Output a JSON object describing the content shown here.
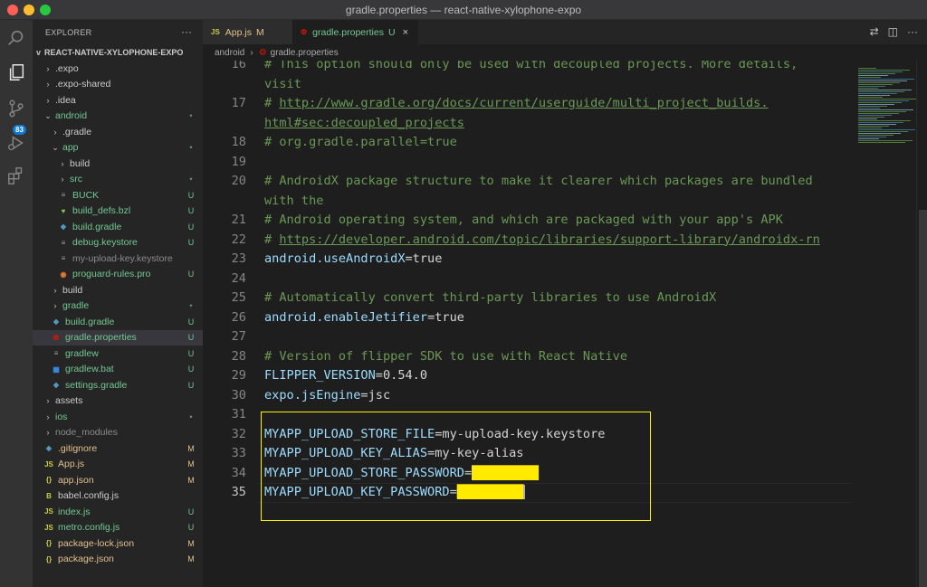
{
  "window": {
    "title": "gradle.properties — react-native-xylophone-expo"
  },
  "activity": {
    "source_control_badge": "83"
  },
  "explorer": {
    "header": "EXPLORER",
    "more": "···",
    "root": "REACT-NATIVE-XYLOPHONE-EXPO",
    "items": [
      {
        "label": ".expo",
        "chev": ">",
        "icon": "",
        "status": ""
      },
      {
        "label": ".expo-shared",
        "chev": ">",
        "icon": "",
        "status": ""
      },
      {
        "label": ".idea",
        "chev": ">",
        "icon": "",
        "status": ""
      },
      {
        "label": "android",
        "chev": "v",
        "icon": "",
        "status": "•"
      },
      {
        "label": ".gradle",
        "chev": ">",
        "icon": "",
        "status": ""
      },
      {
        "label": "app",
        "chev": "v",
        "icon": "",
        "status": "•"
      },
      {
        "label": "build",
        "chev": ">",
        "icon": "",
        "status": ""
      },
      {
        "label": "src",
        "chev": ">",
        "icon": "",
        "status": "•"
      },
      {
        "label": "BUCK",
        "chev": "",
        "icon": "≡",
        "status": "U"
      },
      {
        "label": "build_defs.bzl",
        "chev": "",
        "icon": "♥",
        "status": "U"
      },
      {
        "label": "build.gradle",
        "chev": "",
        "icon": "◆",
        "status": "U"
      },
      {
        "label": "debug.keystore",
        "chev": "",
        "icon": "≡",
        "status": "U"
      },
      {
        "label": "my-upload-key.keystore",
        "chev": "",
        "icon": "≡",
        "status": ""
      },
      {
        "label": "proguard-rules.pro",
        "chev": "",
        "icon": "◉",
        "status": "U"
      },
      {
        "label": "build",
        "chev": ">",
        "icon": "",
        "status": ""
      },
      {
        "label": "gradle",
        "chev": ">",
        "icon": "",
        "status": "•"
      },
      {
        "label": "build.gradle",
        "chev": "",
        "icon": "◆",
        "status": "U"
      },
      {
        "label": "gradle.properties",
        "chev": "",
        "icon": "⚙",
        "status": "U"
      },
      {
        "label": "gradlew",
        "chev": "",
        "icon": "≡",
        "status": "U"
      },
      {
        "label": "gradlew.bat",
        "chev": "",
        "icon": "▦",
        "status": "U"
      },
      {
        "label": "settings.gradle",
        "chev": "",
        "icon": "◆",
        "status": "U"
      },
      {
        "label": "assets",
        "chev": ">",
        "icon": "",
        "status": ""
      },
      {
        "label": "ios",
        "chev": ">",
        "icon": "",
        "status": "•"
      },
      {
        "label": "node_modules",
        "chev": ">",
        "icon": "",
        "status": ""
      },
      {
        "label": ".gitignore",
        "chev": "",
        "icon": "◆",
        "status": "M"
      },
      {
        "label": "App.js",
        "chev": "",
        "icon": "JS",
        "status": "M"
      },
      {
        "label": "app.json",
        "chev": "",
        "icon": "{}",
        "status": "M"
      },
      {
        "label": "babel.config.js",
        "chev": "",
        "icon": "B",
        "status": ""
      },
      {
        "label": "index.js",
        "chev": "",
        "icon": "JS",
        "status": "U"
      },
      {
        "label": "metro.config.js",
        "chev": "",
        "icon": "JS",
        "status": "U"
      },
      {
        "label": "package-lock.json",
        "chev": "",
        "icon": "{}",
        "status": "M"
      },
      {
        "label": "package.json",
        "chev": "",
        "icon": "{}",
        "status": "M"
      }
    ]
  },
  "tabs": [
    {
      "icon": "JS",
      "label": "App.js",
      "mark": "M"
    },
    {
      "icon": "⚙",
      "label": "gradle.properties",
      "mark": "U",
      "close": "×"
    }
  ],
  "breadcrumb": {
    "folder": "android",
    "sep": "›",
    "file": "gradle.properties"
  },
  "editor": {
    "lines": [
      {
        "num": "16",
        "parts": [
          {
            "t": "# This option should only be used with decoupled projects. More details,",
            "c": "cm"
          }
        ]
      },
      {
        "num": "",
        "parts": [
          {
            "t": "visit",
            "c": "cm"
          }
        ]
      },
      {
        "num": "17",
        "parts": [
          {
            "t": "# ",
            "c": "cm"
          },
          {
            "t": "http://www.gradle.org/docs/current/userguide/multi_project_builds.",
            "c": "url"
          }
        ]
      },
      {
        "num": "",
        "parts": [
          {
            "t": "html#sec:decoupled_projects",
            "c": "url"
          }
        ]
      },
      {
        "num": "18",
        "parts": [
          {
            "t": "# org.gradle.parallel=true",
            "c": "cm"
          }
        ]
      },
      {
        "num": "19",
        "parts": []
      },
      {
        "num": "20",
        "parts": [
          {
            "t": "# AndroidX package structure to make it clearer which packages are bundled",
            "c": "cm"
          }
        ]
      },
      {
        "num": "",
        "parts": [
          {
            "t": "with the",
            "c": "cm"
          }
        ]
      },
      {
        "num": "21",
        "parts": [
          {
            "t": "# Android operating system, and which are packaged with your app's APK",
            "c": "cm"
          }
        ]
      },
      {
        "num": "22",
        "parts": [
          {
            "t": "# ",
            "c": "cm"
          },
          {
            "t": "https://developer.android.com/topic/libraries/support-library/androidx-rn",
            "c": "url"
          }
        ]
      },
      {
        "num": "23",
        "parts": [
          {
            "t": "android.useAndroidX",
            "c": "key"
          },
          {
            "t": "=true",
            "c": "val"
          }
        ]
      },
      {
        "num": "24",
        "parts": []
      },
      {
        "num": "25",
        "parts": [
          {
            "t": "# Automatically convert third-party libraries to use AndroidX",
            "c": "cm"
          }
        ]
      },
      {
        "num": "26",
        "parts": [
          {
            "t": "android.enableJetifier",
            "c": "key"
          },
          {
            "t": "=true",
            "c": "val"
          }
        ]
      },
      {
        "num": "27",
        "parts": []
      },
      {
        "num": "28",
        "parts": [
          {
            "t": "# Version of flipper SDK to use with React Native",
            "c": "cm"
          }
        ]
      },
      {
        "num": "29",
        "parts": [
          {
            "t": "FLIPPER_VERSION",
            "c": "key"
          },
          {
            "t": "=0.54.0",
            "c": "val"
          }
        ]
      },
      {
        "num": "30",
        "parts": [
          {
            "t": "expo.jsEngine",
            "c": "key"
          },
          {
            "t": "=jsc",
            "c": "val"
          }
        ]
      },
      {
        "num": "31",
        "parts": []
      },
      {
        "num": "32",
        "parts": [
          {
            "t": "MYAPP_UPLOAD_STORE_FILE",
            "c": "key"
          },
          {
            "t": "=my-upload-key.keystore",
            "c": "val"
          }
        ]
      },
      {
        "num": "33",
        "parts": [
          {
            "t": "MYAPP_UPLOAD_KEY_ALIAS",
            "c": "key"
          },
          {
            "t": "=my-key-alias",
            "c": "val"
          }
        ]
      },
      {
        "num": "34",
        "parts": [
          {
            "t": "MYAPP_UPLOAD_STORE_PASSWORD",
            "c": "key"
          },
          {
            "t": "=",
            "c": "val"
          },
          {
            "t": "█████████",
            "c": "redact"
          }
        ]
      },
      {
        "num": "35",
        "parts": [
          {
            "t": "MYAPP_UPLOAD_KEY_PASSWORD",
            "c": "key"
          },
          {
            "t": "=",
            "c": "val"
          },
          {
            "t": "█████████",
            "c": "redact"
          }
        ]
      }
    ]
  }
}
